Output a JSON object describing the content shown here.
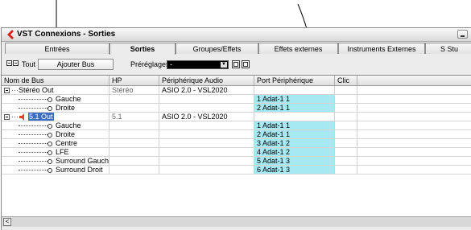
{
  "window": {
    "title": "VST Connexions - Sorties"
  },
  "tabs": [
    {
      "label": "Entrées",
      "active": false
    },
    {
      "label": "Sorties",
      "active": true
    },
    {
      "label": "Groupes/Effets",
      "active": false
    },
    {
      "label": "Effets externes",
      "active": false
    },
    {
      "label": "Instruments Externes",
      "active": false
    },
    {
      "label": "S  Stu",
      "active": false
    }
  ],
  "toolbar": {
    "tout_label": "Tout",
    "add_bus_label": "Ajouter Bus",
    "presets_label": "Préréglages",
    "presets_value": "-"
  },
  "table": {
    "headers": [
      "Nom de Bus",
      "HP",
      "Périphérique Audio",
      "Port Périphérique",
      "Clic"
    ],
    "rows": [
      {
        "name": "Stéréo Out",
        "hp": "Stéréo",
        "device": "ASIO 2.0 - VSL2020",
        "port": "",
        "type": "bus"
      },
      {
        "name": "Gauche",
        "hp": "",
        "device": "",
        "port": "1 Adat-1 1",
        "type": "channel"
      },
      {
        "name": "Droite",
        "hp": "",
        "device": "",
        "port": "2 Adat-1 1",
        "type": "channel"
      },
      {
        "name": "5.1 Out",
        "hp": "5.1",
        "device": "ASIO 2.0 - VSL2020",
        "port": "",
        "type": "bus51"
      },
      {
        "name": "Gauche",
        "hp": "",
        "device": "",
        "port": "1 Adat-1 1",
        "type": "channel"
      },
      {
        "name": "Droite",
        "hp": "",
        "device": "",
        "port": "2 Adat-1 1",
        "type": "channel"
      },
      {
        "name": "Centre",
        "hp": "",
        "device": "",
        "port": "3 Adat-1 2",
        "type": "channel"
      },
      {
        "name": "LFE",
        "hp": "",
        "device": "",
        "port": "4 Adat-1 2",
        "type": "channel"
      },
      {
        "name": "Surround Gauche",
        "hp": "",
        "device": "",
        "port": "5 Adat-1 3",
        "type": "channel"
      },
      {
        "name": "Surround Droit",
        "hp": "",
        "device": "",
        "port": "6 Adat-1 3",
        "type": "channel"
      }
    ]
  },
  "colors": {
    "port_highlight": "#a7e9f3",
    "selection": "#3b6fc4",
    "logo_red": "#d8231f"
  }
}
